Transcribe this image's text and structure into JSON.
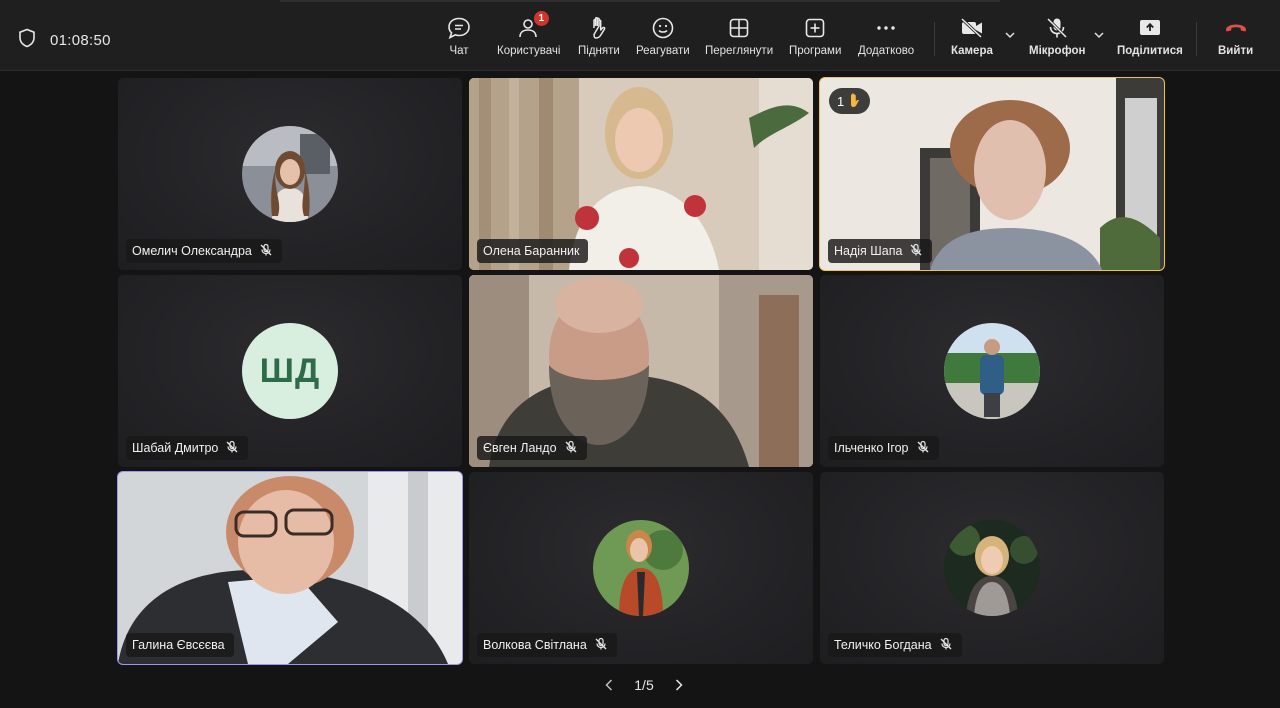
{
  "meeting": {
    "timer": "01:08:50",
    "shield_icon": "shield-icon"
  },
  "toolbar": {
    "chat": {
      "label": "Чат",
      "icon": "chat-icon"
    },
    "people": {
      "label": "Користувачі",
      "icon": "people-icon",
      "badge": "1"
    },
    "raise": {
      "label": "Підняти",
      "icon": "raise-hand-icon"
    },
    "react": {
      "label": "Реагувати",
      "icon": "smile-icon"
    },
    "view": {
      "label": "Переглянути",
      "icon": "grid-view-icon"
    },
    "apps": {
      "label": "Програми",
      "icon": "apps-plus-icon"
    },
    "more": {
      "label": "Додатково",
      "icon": "more-icon"
    },
    "camera": {
      "label": "Камера",
      "icon": "camera-off-icon"
    },
    "mic": {
      "label": "Мікрофон",
      "icon": "mic-off-icon"
    },
    "share": {
      "label": "Поділитися",
      "icon": "share-screen-icon"
    },
    "leave": {
      "label": "Вийти",
      "icon": "phone-hangup-icon",
      "color": "#e0504a"
    }
  },
  "participants": [
    {
      "name": "Омелич Олександра",
      "muted": true
    },
    {
      "name": "Олена Баранник",
      "muted": false
    },
    {
      "name": "Надія Шапа",
      "muted": true,
      "raised_hand": "1",
      "highlight": "#f0c342"
    },
    {
      "name": "Шабай Дмитро",
      "muted": true,
      "initials": "ШД"
    },
    {
      "name": "Євген Ландо",
      "muted": true
    },
    {
      "name": "Ільченко Ігор",
      "muted": true
    },
    {
      "name": "Галина Євсєєва",
      "muted": false,
      "highlight": "#9c98f0"
    },
    {
      "name": "Волкова Світлана",
      "muted": true
    },
    {
      "name": "Теличко Богдана",
      "muted": true
    }
  ],
  "pager": {
    "text": "1/5"
  }
}
